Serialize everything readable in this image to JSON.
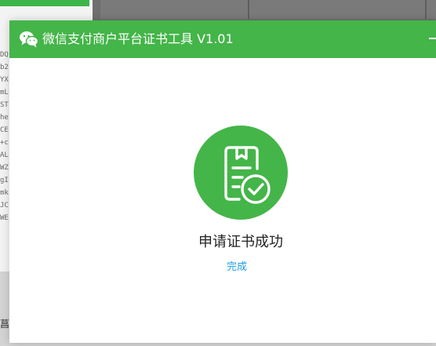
{
  "window": {
    "title": "微信支付商户平台证书工具 V1.01",
    "accent_color": "#44b549"
  },
  "result": {
    "icon": "certificate-check-icon",
    "message": "申请证书成功",
    "done_label": "完成",
    "link_color": "#1e9fe8"
  },
  "background": {
    "code_fragments": [
      "DQ",
      "b2",
      "YX",
      "mL",
      "ST",
      "he",
      "CE",
      "+c",
      "AL",
      "WZ",
      "gI",
      "mk",
      "JC",
      "WE"
    ],
    "bottom_label": "菖"
  }
}
